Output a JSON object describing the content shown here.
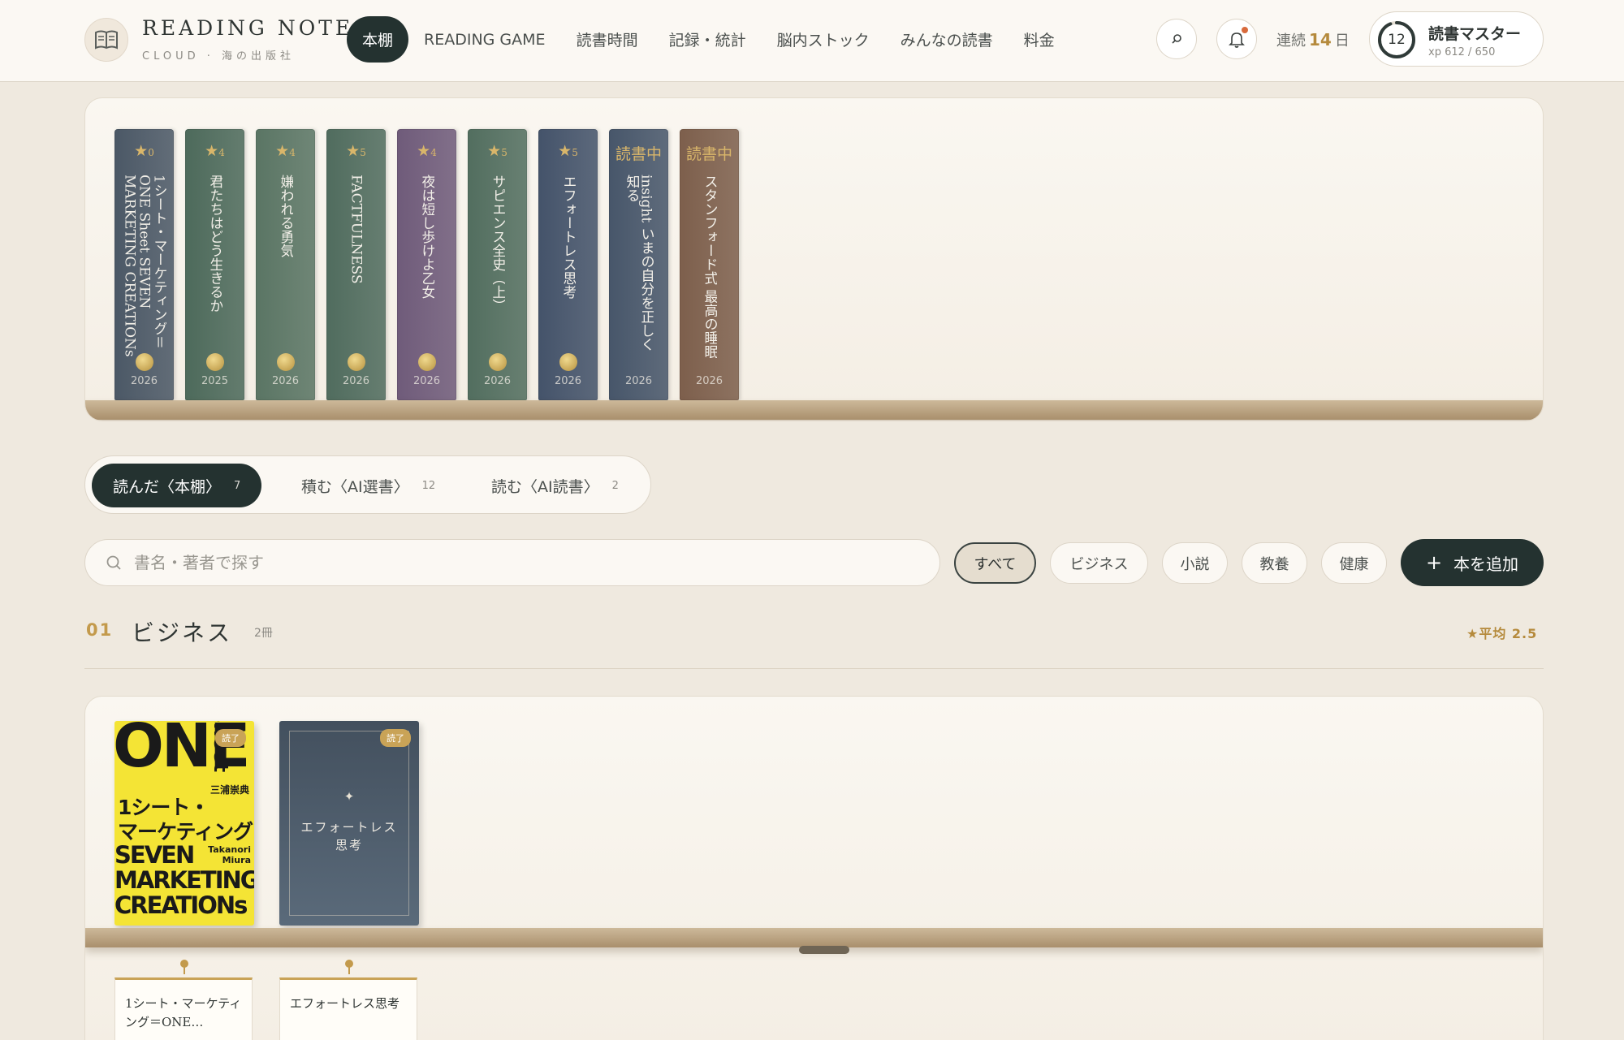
{
  "header": {
    "logo_title": "READING NOTE",
    "logo_sub": "CLOUD · 海の出版社",
    "nav": [
      "本棚",
      "READING GAME",
      "読書時間",
      "記録・統計",
      "脳内ストック",
      "みんなの読書",
      "料金"
    ],
    "active_nav": "本棚",
    "streak_label": "連続",
    "streak_days": "14",
    "streak_unit": "日",
    "level": "12",
    "rank": "読書マスター",
    "xp": "xp 612 / 650",
    "xp_progress": 0.94
  },
  "shelf_spines": [
    {
      "top": "★",
      "rating": "0",
      "title": "1シート・マーケティング＝ONE Sheet SEVEN MARKETING CREATIONs",
      "year": "2026",
      "color": "#4b5866"
    },
    {
      "top": "★",
      "rating": "4",
      "title": "君たちはどう生きるか",
      "year": "2025",
      "color": "#4d6a5b"
    },
    {
      "top": "★",
      "rating": "4",
      "title": "嫌われる勇気",
      "year": "2026",
      "color": "#5a7564"
    },
    {
      "top": "★",
      "rating": "5",
      "title": "FACTFULNESS",
      "year": "2026",
      "color": "#506c5e"
    },
    {
      "top": "★",
      "rating": "4",
      "title": "夜は短し歩けよ乙女",
      "year": "2026",
      "color": "#6f5b7a"
    },
    {
      "top": "★",
      "rating": "5",
      "title": "サピエンス全史（上）",
      "year": "2026",
      "color": "#526e5f"
    },
    {
      "top": "★",
      "rating": "5",
      "title": "エフォートレス思考",
      "year": "2026",
      "color": "#44536a"
    },
    {
      "top": "読書中",
      "rating": "",
      "title": "insight いまの自分を正しく知る",
      "year": "2026",
      "color": "#47566a"
    },
    {
      "top": "読書中",
      "rating": "",
      "title": "スタンフォード式 最高の睡眠",
      "year": "2026",
      "color": "#7d5f4c"
    }
  ],
  "tabs": [
    {
      "label": "読んだ〈本棚〉",
      "count": "7"
    },
    {
      "label": "積む〈AI選書〉",
      "count": "12"
    },
    {
      "label": "読む〈AI読書〉",
      "count": "2"
    }
  ],
  "search": {
    "placeholder": "書名・著者で探す"
  },
  "filters": [
    "すべて",
    "ビジネス",
    "小説",
    "教養",
    "健康"
  ],
  "add_button": "本を追加",
  "section": {
    "num": "01",
    "title": "ビジネス",
    "count": "2冊",
    "avg": "★平均 2.5"
  },
  "books": [
    {
      "badge": "読了",
      "cover": {
        "one": "ONE",
        "sheet": "Sheet",
        "author": "三浦崇典",
        "jp_line1": "1シート・",
        "jp_line2": "マーケティング",
        "en_line1": "SEVEN",
        "en_line2": "MARKETING",
        "en_line3": "CREATIONs",
        "en_author_1": "Takanori",
        "en_author_2": "Miura"
      },
      "card_title": "1シート・マーケティング＝ONE…"
    },
    {
      "badge": "読了",
      "cover_star": "✦",
      "cover_title_1": "エフォートレス",
      "cover_title_2": "思考",
      "card_title": "エフォートレス思考"
    }
  ]
}
